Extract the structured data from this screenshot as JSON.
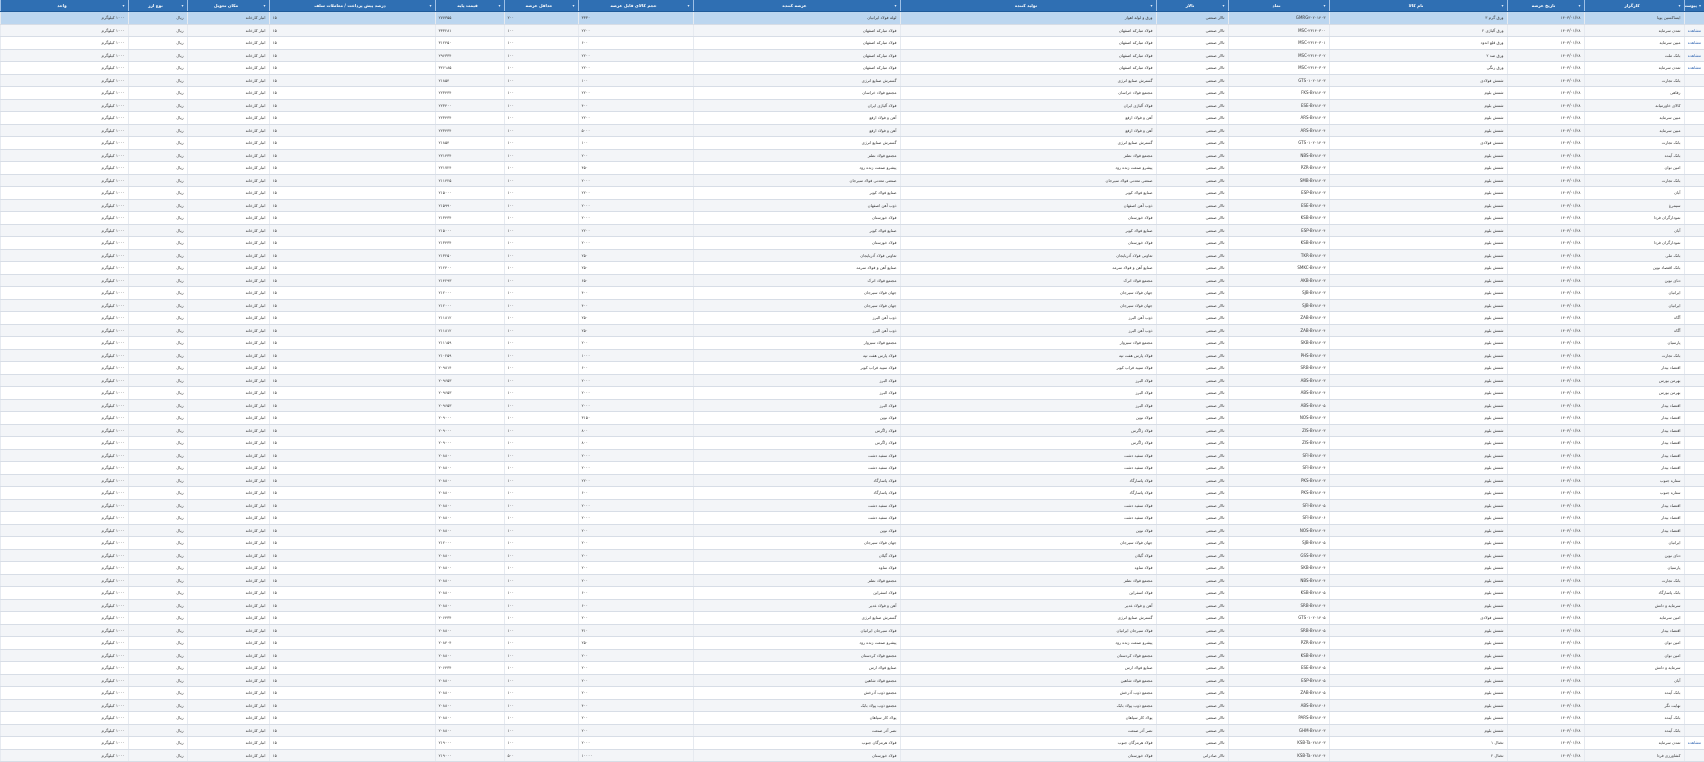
{
  "columns": [
    "پیوست",
    "کارگزار",
    "تاریخ عرضه",
    "نام کالا",
    "نماد",
    "تالار",
    "تولید کننده",
    "عرضه کننده",
    "حجم کالای قابل عرضه",
    "حداقل عرضه",
    "قیمت پایه",
    "درصد پیش پرداخت / معاملات سلف",
    "مکان تحویل",
    "نوع ارز",
    "واحد"
  ],
  "rows": [
    [
      "",
      "ایساکسین پویا",
      "۱۴۰۳/۰۱/۲۸",
      "ورق گرم ۳",
      "GMRG۳۰۲۰۱۴۰۳",
      "تالار صنعتی",
      "ورق و لوله اهواز",
      "لوله فولاد ایرانیان",
      "۳۳۳۰",
      "۲۰۰",
      "۲۷۷۳۵۵",
      "۱۵",
      "انبار کارخانه",
      "ریال",
      "۱۰۰۰ کیلوگرم"
    ],
    [
      "مشاهده",
      "تمدن سرمایه",
      "۱۴۰۳/۰۱/۲۸",
      "ورق آلیاژی ۲",
      "MSC-۲۳۱۴۰۳۰۰",
      "تالار صنعتی",
      "فولاد مبارکه اصفهان",
      "فولاد مبارکه اصفهان",
      "۲۲۰۰",
      "۱۰۰",
      "۳۳۳۲۸۱",
      "۱۵",
      "انبار کارخانه",
      "ریال",
      "۱۰۰۰ کیلوگرم"
    ],
    [
      "مشاهده",
      "مبین سرمایه",
      "۱۴۰۳/۰۱/۲۸",
      "ورق قلع اندود",
      "MSC-۲۳۱۴۰۳۰۱",
      "تالار صنعتی",
      "فولاد مبارکه اصفهان",
      "فولاد مبارکه اصفهان",
      "۶۰۰",
      "۱۰۰",
      "۳۱۲۴۵۰",
      "۱۵",
      "انبار کارخانه",
      "ریال",
      "۱۰۰۰ کیلوگرم"
    ],
    [
      "مشاهده",
      "بانک ملت",
      "۱۴۰۳/۰۱/۲۸",
      "ورق ضد ۲",
      "MSC-۲۳۱۴۰۳۰۲",
      "تالار صنعتی",
      "فولاد مبارکه اصفهان",
      "فولاد مبارکه اصفهان",
      "۲۲۰۰",
      "۱۰۰",
      "۲۹۶۳۳۴",
      "۱۵",
      "انبار کارخانه",
      "ریال",
      "۱۰۰۰ کیلوگرم"
    ],
    [
      "مشاهده",
      "تمدن سرمایه",
      "۱۴۰۳/۰۱/۲۸",
      "ورق رنگی",
      "MSC-۲۳۱۴۰۳۰۳",
      "تالار صنعتی",
      "فولاد مبارکه اصفهان",
      "فولاد مبارکه اصفهان",
      "۲۲۰۰",
      "۱۰۰",
      "۳۲۶۱۸۵",
      "۱۵",
      "انبار کارخانه",
      "ریال",
      "۱۰۰۰ کیلوگرم"
    ],
    [
      "",
      "بانک تجارت",
      "۱۴۰۳/۰۱/۲۸",
      "شمش فولادی",
      "GTS۰۱۰۲۰۱۴۰۳",
      "تالار صنعتی",
      "گسترش صنایع انرژی",
      "گسترش صنایع انرژی",
      "۱۰۰",
      "۱۰۰",
      "۲۱۸۵۴",
      "۱۵",
      "انبار کارخانه",
      "ریال",
      "۱۰۰۰ کیلوگرم"
    ],
    [
      "",
      "رفاهی",
      "۱۴۰۳/۰۱/۲۸",
      "شمش بلوم",
      "FKS-B۲۸۱۴۰۳",
      "تالار صنعتی",
      "مجتمع فولاد خراسان",
      "مجتمع فولاد خراسان",
      "۲۲۰۰",
      "۱۰۰",
      "۲۲۳۴۳۴",
      "۱۵",
      "انبار کارخانه",
      "ریال",
      "۱۰۰۰ کیلوگرم"
    ],
    [
      "",
      "کالای خاورمیانه",
      "۱۴۰۳/۰۱/۲۸",
      "شمش بلوم",
      "ESE-B۲۸۱۴۰۳",
      "تالار صنعتی",
      "فولاد آلیاژی ایران",
      "فولاد آلیاژی ایران",
      "۴۰۰",
      "۱۰۰",
      "۲۲۳۴۰۰",
      "۱۵",
      "انبار کارخانه",
      "ریال",
      "۱۰۰۰ کیلوگرم"
    ],
    [
      "",
      "مبین سرمایه",
      "۱۴۰۳/۰۱/۲۸",
      "شمش بلوم",
      "ARS-B۲۸۱۴۰۳",
      "تالار صنعتی",
      "آهن و فولاد ارفع",
      "آهن و فولاد ارفع",
      "۲۲۰۰",
      "۱۰۰",
      "۲۲۳۴۳۴",
      "۱۵",
      "انبار کارخانه",
      "ریال",
      "۱۰۰۰ کیلوگرم"
    ],
    [
      "",
      "مبین سرمایه",
      "۱۴۰۳/۰۱/۲۸",
      "شمش بلوم",
      "ARS-B۲۸۱۴۰۴",
      "تالار صنعتی",
      "آهن و فولاد ارفع",
      "آهن و فولاد ارفع",
      "۵۰۰۰",
      "۱۰۰",
      "۲۲۳۴۳۴",
      "۱۵",
      "انبار کارخانه",
      "ریال",
      "۱۰۰۰ کیلوگرم"
    ],
    [
      "",
      "بانک تجارت",
      "۱۴۰۳/۰۱/۲۸",
      "شمش فولادی",
      "GTS۰۱۰۲۰۱۴۰۴",
      "تالار صنعتی",
      "گسترش صنایع انرژی",
      "گسترش صنایع انرژی",
      "۱۰۰",
      "۱۰۰",
      "۲۱۸۵۴",
      "۱۵",
      "انبار کارخانه",
      "ریال",
      "۱۰۰۰ کیلوگرم"
    ],
    [
      "",
      "بانک آینده",
      "۱۴۰۳/۰۱/۲۸",
      "شمش بلوم",
      "NBS-B۲۸۱۴۰۳",
      "تالار صنعتی",
      "مجتمع فولاد نطنز",
      "مجتمع فولاد نطنز",
      "۲۰۰",
      "۱۰۰",
      "۲۲۱۴۳۴",
      "۱۵",
      "انبار کارخانه",
      "ریال",
      "۱۰۰۰ کیلوگرم"
    ],
    [
      "",
      "امین توان",
      "۱۴۰۳/۰۱/۲۸",
      "شمش بلوم",
      "PZR-B۲۸۱۴۰۳",
      "تالار صنعتی",
      "پیشرو صنعت زنده رود",
      "پیشرو صنعت زنده رود",
      "۴۵۰",
      "۱۰۰",
      "۲۲۱۷۲۴",
      "۱۵",
      "انبار کارخانه",
      "ریال",
      "۱۰۰۰ کیلوگرم"
    ],
    [
      "",
      "بانک تجارت",
      "۱۴۰۳/۰۱/۲۸",
      "شمش بلوم",
      "SMB-B۲۸۱۴۰۳",
      "تالار صنعتی",
      "صنعتی معدنی فولاد سیرجان",
      "صنعتی معدنی فولاد سیرجان",
      "۲۰۰۰",
      "۱۰۰",
      "۲۱۱۴۲۵",
      "۱۵",
      "انبار کارخانه",
      "ریال",
      "۱۰۰۰ کیلوگرم"
    ],
    [
      "",
      "آبان",
      "۱۴۰۳/۰۱/۲۸",
      "شمش بلوم",
      "ESP-B۲۸۱۴۰۳",
      "تالار صنعتی",
      "صنایع فولاد کویر",
      "صنایع فولاد کویر",
      "۲۲۰۰",
      "۱۰۰",
      "۲۱۵۰۰۰",
      "۱۵",
      "انبار کارخانه",
      "ریال",
      "۱۰۰۰ کیلوگرم"
    ],
    [
      "",
      "سیمرغ",
      "۱۴۰۳/۰۱/۲۸",
      "شمش بلوم",
      "ESE-B۲۸۱۴۰۴",
      "تالار صنعتی",
      "ذوب آهن اصفهان",
      "ذوب آهن اصفهان",
      "۲۰۰۰",
      "۱۰۰",
      "۲۱۵۹۹۰",
      "۱۵",
      "انبار کارخانه",
      "ریال",
      "۱۰۰۰ کیلوگرم"
    ],
    [
      "",
      "نمودارگران فردا",
      "۱۴۰۳/۰۱/۲۸",
      "شمش بلوم",
      "KSB-B۲۸۱۴۰۳",
      "تالار صنعتی",
      "فولاد خوزستان",
      "فولاد خوزستان",
      "۲۰۰۰",
      "۱۰۰",
      "۲۱۳۴۳۴",
      "۱۵",
      "انبار کارخانه",
      "ریال",
      "۱۰۰۰ کیلوگرم"
    ],
    [
      "",
      "آبان",
      "۱۴۰۳/۰۱/۲۸",
      "شمش بلوم",
      "ESP-B۲۸۱۴۰۴",
      "تالار صنعتی",
      "صنایع فولاد کویر",
      "صنایع فولاد کویر",
      "۲۲۰۰",
      "۱۰۰",
      "۲۱۵۰۰۰",
      "۱۵",
      "انبار کارخانه",
      "ریال",
      "۱۰۰۰ کیلوگرم"
    ],
    [
      "",
      "نمودارگران فردا",
      "۱۴۰۳/۰۱/۲۸",
      "شمش بلوم",
      "KSB-B۲۸۱۴۰۴",
      "تالار صنعتی",
      "فولاد خوزستان",
      "فولاد خوزستان",
      "۲۰۰۰",
      "۱۰۰",
      "۲۱۳۴۳۴",
      "۱۵",
      "انبار کارخانه",
      "ریال",
      "۱۰۰۰ کیلوگرم"
    ],
    [
      "",
      "بانک ملی",
      "۱۴۰۳/۰۱/۲۸",
      "شمش بلوم",
      "TKR-B۲۸۱۴۰۳",
      "تالار صنعتی",
      "تعاونی فولاد آذربایجان",
      "تعاونی فولاد آذربایجان",
      "۲۵۰",
      "۱۰۰",
      "۲۱۳۲۵۰",
      "۱۵",
      "انبار کارخانه",
      "ریال",
      "۱۰۰۰ کیلوگرم"
    ],
    [
      "",
      "بانک اقتصاد نوین",
      "۱۴۰۳/۰۱/۲۸",
      "شمش بلوم",
      "SMKC-B۲۸۱۴۰۳",
      "تالار صنعتی",
      "صنایع آهن و فولاد سرمد",
      "صنایع آهن و فولاد سرمد",
      "۲۵۰",
      "۱۰۰",
      "۲۱۲۴۰۰",
      "۱۵",
      "انبار کارخانه",
      "ریال",
      "۱۰۰۰ کیلوگرم"
    ],
    [
      "",
      "دنای نوین",
      "۱۴۰۳/۰۱/۲۸",
      "شمش بلوم",
      "AKB-B۲۸۱۴۰۳",
      "تالار صنعتی",
      "مجتمع فولاد اترک",
      "مجتمع فولاد اترک",
      "۶۵۰",
      "۱۰۰",
      "۲۱۴۲۹۳",
      "۱۵",
      "انبار کارخانه",
      "ریال",
      "۱۰۰۰ کیلوگرم"
    ],
    [
      "",
      "ایرانیان",
      "۱۴۰۳/۰۱/۲۸",
      "شمش بلوم",
      "SJB-B۲۸۱۴۰۳",
      "تالار صنعتی",
      "جهان فولاد سیرجان",
      "جهان فولاد سیرجان",
      "۴۰۰",
      "۱۰۰",
      "۲۱۲۰۰۰",
      "۱۵",
      "انبار کارخانه",
      "ریال",
      "۱۰۰۰ کیلوگرم"
    ],
    [
      "",
      "ایرانیان",
      "۱۴۰۳/۰۱/۲۸",
      "شمش بلوم",
      "SJB-B۲۸۱۴۰۴",
      "تالار صنعتی",
      "جهان فولاد سیرجان",
      "جهان فولاد سیرجان",
      "۴۰۰",
      "۱۰۰",
      "۲۱۲۰۰۰",
      "۱۵",
      "انبار کارخانه",
      "ریال",
      "۱۰۰۰ کیلوگرم"
    ],
    [
      "",
      "آگاه",
      "۱۴۰۳/۰۱/۲۸",
      "شمش بلوم",
      "ZAB-B۲۸۱۴۰۳",
      "تالار صنعتی",
      "ذوب آهن البرز",
      "ذوب آهن البرز",
      "۲۵۰",
      "۱۰۰",
      "۲۱۱۸۱۲",
      "۱۵",
      "انبار کارخانه",
      "ریال",
      "۱۰۰۰ کیلوگرم"
    ],
    [
      "",
      "آگاه",
      "۱۴۰۳/۰۱/۲۸",
      "شمش بلوم",
      "ZAB-B۲۸۱۴۰۴",
      "تالار صنعتی",
      "ذوب آهن البرز",
      "ذوب آهن البرز",
      "۲۵۰",
      "۱۰۰",
      "۲۱۱۸۱۲",
      "۱۵",
      "انبار کارخانه",
      "ریال",
      "۱۰۰۰ کیلوگرم"
    ],
    [
      "",
      "پارسیان",
      "۱۴۰۳/۰۱/۲۸",
      "شمش بلوم",
      "SKB-B۲۸۱۴۰۳",
      "تالار صنعتی",
      "مجتمع فولاد سبزوار",
      "مجتمع فولاد سبزوار",
      "۲۰۰",
      "۱۰۰",
      "۲۱۱۱۵۹",
      "۱۵",
      "انبار کارخانه",
      "ریال",
      "۱۰۰۰ کیلوگرم"
    ],
    [
      "",
      "بانک تجارت",
      "۱۴۰۳/۰۱/۲۸",
      "شمش بلوم",
      "PHS-B۲۸۱۴۰۳",
      "تالار صنعتی",
      "فولاد پارس هفت تپه",
      "فولاد پارس هفت تپه",
      "۱۰۰۰",
      "۱۰۰",
      "۲۱۰۲۵۹",
      "۱۵",
      "انبار کارخانه",
      "ریال",
      "۱۰۰۰ کیلوگرم"
    ],
    [
      "",
      "اقتصاد بیدار",
      "۱۴۰۳/۰۱/۲۸",
      "شمش بلوم",
      "SRB-B۲۸۱۴۰۳",
      "تالار صنعتی",
      "فولاد سپید فراب کویر",
      "فولاد سپید فراب کویر",
      "۶۰۰",
      "۱۰۰",
      "۲۰۹۸۱۴",
      "۱۵",
      "انبار کارخانه",
      "ریال",
      "۱۰۰۰ کیلوگرم"
    ],
    [
      "",
      "بهرمن بورس",
      "۱۴۰۳/۰۱/۲۸",
      "شمش بلوم",
      "ABS-B۲۸۱۴۰۳",
      "تالار صنعتی",
      "فولاد البرز",
      "فولاد البرز",
      "۲۰۰۰",
      "۱۰۰",
      "۲۰۹۶۵۳",
      "۱۵",
      "انبار کارخانه",
      "ریال",
      "۱۰۰۰ کیلوگرم"
    ],
    [
      "",
      "بهرمن بورس",
      "۱۴۰۳/۰۱/۲۸",
      "شمش بلوم",
      "ABS-B۲۸۱۴۰۴",
      "تالار صنعتی",
      "فولاد البرز",
      "فولاد البرز",
      "۲۰۰۰",
      "۱۰۰",
      "۲۰۹۶۵۳",
      "۱۵",
      "انبار کارخانه",
      "ریال",
      "۱۰۰۰ کیلوگرم"
    ],
    [
      "",
      "اقتصاد بیدار",
      "۱۴۰۳/۰۱/۲۸",
      "شمش بلوم",
      "ABS-B۲۸۱۴۰۵",
      "تالار صنعتی",
      "فولاد البرز",
      "فولاد البرز",
      "۲۰۰۰",
      "۱۰۰",
      "۲۰۹۶۵۳",
      "۱۵",
      "انبار کارخانه",
      "ریال",
      "۱۰۰۰ کیلوگرم"
    ],
    [
      "",
      "اقتصاد بیدار",
      "۱۴۰۳/۰۱/۲۸",
      "شمش بلوم",
      "NOS-B۲۸۱۴۰۳",
      "تالار صنعتی",
      "فولاد نوین",
      "فولاد نوین",
      "۳۱۵۰",
      "۱۰۰",
      "۲۰۹۰۰۰",
      "۱۵",
      "انبار کارخانه",
      "ریال",
      "۱۰۰۰ کیلوگرم"
    ],
    [
      "",
      "اقتصاد بیدار",
      "۱۴۰۳/۰۱/۲۸",
      "شمش بلوم",
      "ZIS-B۲۸۱۴۰۳",
      "تالار صنعتی",
      "فولاد زاگرس",
      "فولاد زاگرس",
      "۸۰۰",
      "۱۰۰",
      "۲۰۹۰۰۰",
      "۱۵",
      "انبار کارخانه",
      "ریال",
      "۱۰۰۰ کیلوگرم"
    ],
    [
      "",
      "اقتصاد بیدار",
      "۱۴۰۳/۰۱/۲۸",
      "شمش بلوم",
      "ZIS-B۲۸۱۴۰۴",
      "تالار صنعتی",
      "فولاد زاگرس",
      "فولاد زاگرس",
      "۸۰۰",
      "۱۰۰",
      "۲۰۹۰۰۰",
      "۱۵",
      "انبار کارخانه",
      "ریال",
      "۱۰۰۰ کیلوگرم"
    ],
    [
      "",
      "اقتصاد بیدار",
      "۱۴۰۳/۰۱/۲۸",
      "شمش بلوم",
      "SFI-B۲۸۱۴۰۳",
      "تالار صنعتی",
      "فولاد سفید دشت",
      "فولاد سفید دشت",
      "۲۰۰۰",
      "۱۰۰",
      "۲۰۸۸۰۰",
      "۱۵",
      "انبار کارخانه",
      "ریال",
      "۱۰۰۰ کیلوگرم"
    ],
    [
      "",
      "اقتصاد بیدار",
      "۱۴۰۳/۰۱/۲۸",
      "شمش بلوم",
      "SFI-B۲۸۱۴۰۴",
      "تالار صنعتی",
      "فولاد سفید دشت",
      "فولاد سفید دشت",
      "۲۰۰۰",
      "۱۰۰",
      "۲۰۸۸۰۰",
      "۱۵",
      "انبار کارخانه",
      "ریال",
      "۱۰۰۰ کیلوگرم"
    ],
    [
      "",
      "ستاره جنوب",
      "۱۴۰۳/۰۱/۲۸",
      "شمش بلوم",
      "PKS-B۲۸۱۴۰۳",
      "تالار صنعتی",
      "فولاد پاسارگاد",
      "فولاد پاسارگاد",
      "۲۲۰۰",
      "۱۰۰",
      "۲۰۸۸۰۰",
      "۱۵",
      "انبار کارخانه",
      "ریال",
      "۱۰۰۰ کیلوگرم"
    ],
    [
      "",
      "ستاره جنوب",
      "۱۴۰۳/۰۱/۲۸",
      "شمش بلوم",
      "PKS-B۲۸۱۴۰۴",
      "تالار صنعتی",
      "فولاد پاسارگاد",
      "فولاد پاسارگاد",
      "۶۰۰",
      "۱۰۰",
      "۲۰۸۸۰۰",
      "۱۵",
      "انبار کارخانه",
      "ریال",
      "۱۰۰۰ کیلوگرم"
    ],
    [
      "",
      "اقتصاد بیدار",
      "۱۴۰۳/۰۱/۲۸",
      "شمش بلوم",
      "SFI-B۲۸۱۴۰۵",
      "تالار صنعتی",
      "فولاد سفید دشت",
      "فولاد سفید دشت",
      "۲۰۰۰",
      "۱۰۰",
      "۲۰۸۸۰۰",
      "۱۵",
      "انبار کارخانه",
      "ریال",
      "۱۰۰۰ کیلوگرم"
    ],
    [
      "",
      "اقتصاد بیدار",
      "۱۴۰۳/۰۱/۲۸",
      "شمش بلوم",
      "SFI-B۲۸۱۴۰۶",
      "تالار صنعتی",
      "فولاد سفید دشت",
      "فولاد سفید دشت",
      "۲۰۰۰",
      "۱۰۰",
      "۲۰۸۸۰۰",
      "۱۵",
      "انبار کارخانه",
      "ریال",
      "۱۰۰۰ کیلوگرم"
    ],
    [
      "",
      "اقتصاد بیدار",
      "۱۴۰۳/۰۱/۲۸",
      "شمش بلوم",
      "NOS-B۲۸۱۴۰۴",
      "تالار صنعتی",
      "فولاد نوین",
      "فولاد نوین",
      "۲۰۰",
      "۱۰۰",
      "۲۰۸۸۰۰",
      "۱۵",
      "انبار کارخانه",
      "ریال",
      "۱۰۰۰ کیلوگرم"
    ],
    [
      "",
      "ایرانیان",
      "۱۴۰۳/۰۱/۲۸",
      "شمش بلوم",
      "SJB-B۲۸۱۴۰۵",
      "تالار صنعتی",
      "جهان فولاد سیرجان",
      "جهان فولاد سیرجان",
      "۲۰۰",
      "۱۰۰",
      "۲۱۲۰۰۰",
      "۱۵",
      "انبار کارخانه",
      "ریال",
      "۱۰۰۰ کیلوگرم"
    ],
    [
      "",
      "دنای نوین",
      "۱۴۰۳/۰۱/۲۸",
      "شمش بلوم",
      "GSS-B۲۸۱۴۰۳",
      "تالار صنعتی",
      "فولاد گیلان",
      "فولاد گیلان",
      "۲۰۰",
      "۱۰۰",
      "۲۰۸۸۰۰",
      "۱۵",
      "انبار کارخانه",
      "ریال",
      "۱۰۰۰ کیلوگرم"
    ],
    [
      "",
      "پارسیان",
      "۱۴۰۳/۰۱/۲۸",
      "شمش بلوم",
      "SKB-B۲۸۱۴۰۴",
      "تالار صنعتی",
      "فولاد ساوه",
      "فولاد ساوه",
      "۲۰۰",
      "۱۰۰",
      "۲۰۸۸۰۰",
      "۱۵",
      "انبار کارخانه",
      "ریال",
      "۱۰۰۰ کیلوگرم"
    ],
    [
      "",
      "بانک تجارت",
      "۱۴۰۳/۰۱/۲۸",
      "شمش بلوم",
      "NBS-B۲۸۱۴۰۴",
      "تالار صنعتی",
      "مجتمع فولاد نطنز",
      "مجتمع فولاد نطنز",
      "۲۰۰",
      "۱۰۰",
      "۲۰۸۸۰۰",
      "۱۵",
      "انبار کارخانه",
      "ریال",
      "۱۰۰۰ کیلوگرم"
    ],
    [
      "",
      "بانک پاسارگاد",
      "۱۴۰۳/۰۱/۲۸",
      "شمش بلوم",
      "KSB-B۲۸۱۴۰۵",
      "تالار صنعتی",
      "فولاد اسفراین",
      "فولاد اسفراین",
      "۶۰۰",
      "۱۰۰",
      "۲۰۸۸۰۰",
      "۱۵",
      "انبار کارخانه",
      "ریال",
      "۱۰۰۰ کیلوگرم"
    ],
    [
      "",
      "سرمایه و دانش",
      "۱۴۰۳/۰۱/۲۸",
      "شمش بلوم",
      "SRB-B۲۸۱۴۰۴",
      "تالار صنعتی",
      "آهن و فولاد غدیر",
      "آهن و فولاد غدیر",
      "۶۰۰",
      "۱۰۰",
      "۲۰۸۸۰۰",
      "۱۵",
      "انبار کارخانه",
      "ریال",
      "۱۰۰۰ کیلوگرم"
    ],
    [
      "",
      "امین سرمایه",
      "۱۴۰۳/۰۱/۲۸",
      "شمش فولادی",
      "GTS۰۱۰۲۰۱۴۰۵",
      "تالار صنعتی",
      "گسترش صنایع انرژی",
      "گسترش صنایع انرژی",
      "۲۰۰",
      "۱۰۰",
      "۲۰۶۴۳۴",
      "۱۵",
      "انبار کارخانه",
      "ریال",
      "۱۰۰۰ کیلوگرم"
    ],
    [
      "",
      "اقتصاد بیدار",
      "۱۴۰۳/۰۱/۲۸",
      "شمش بلوم",
      "SRB-B۲۸۱۴۰۵",
      "تالار صنعتی",
      "فولاد سیرجان ایرانیان",
      "فولاد سیرجان ایرانیان",
      "۳۱۰",
      "۱۰۰",
      "۲۰۸۸۰۰",
      "۱۵",
      "انبار کارخانه",
      "ریال",
      "۱۰۰۰ کیلوگرم"
    ],
    [
      "",
      "امین توان",
      "۱۴۰۳/۰۱/۲۸",
      "شمش بلوم",
      "PZR-B۲۸۱۴۰۴",
      "تالار صنعتی",
      "پیشرو صنعت زنده رود",
      "پیشرو صنعت زنده رود",
      "۲۵۰",
      "۱۰۰",
      "۲۰۸۴۰۴",
      "۱۵",
      "انبار کارخانه",
      "ریال",
      "۱۰۰۰ کیلوگرم"
    ],
    [
      "",
      "امین توان",
      "۱۴۰۳/۰۱/۲۸",
      "شمش بلوم",
      "KSB-B۲۸۱۴۰۶",
      "تالار صنعتی",
      "مجتمع فولاد کردستان",
      "مجتمع فولاد کردستان",
      "۲۰۰",
      "۱۰۰",
      "۲۰۸۸۰۰",
      "۱۵",
      "انبار کارخانه",
      "ریال",
      "۱۰۰۰ کیلوگرم"
    ],
    [
      "",
      "سرمایه و دانش",
      "۱۴۰۳/۰۱/۲۸",
      "شمش بلوم",
      "ESE-B۲۸۱۴۰۵",
      "تالار صنعتی",
      "صنایع فولاد ارس",
      "صنایع فولاد ارس",
      "۲۰۰",
      "۱۰۰",
      "۲۰۶۴۳۴",
      "۱۵",
      "انبار کارخانه",
      "ریال",
      "۱۰۰۰ کیلوگرم"
    ],
    [
      "",
      "آبان",
      "۱۴۰۳/۰۱/۲۸",
      "شمش بلوم",
      "ESP-B۲۸۱۴۰۵",
      "تالار صنعتی",
      "مجتمع فولاد شاهین",
      "مجتمع فولاد شاهین",
      "۲۰۰",
      "۱۰۰",
      "۲۰۸۸۰۰",
      "۱۵",
      "انبار کارخانه",
      "ریال",
      "۱۰۰۰ کیلوگرم"
    ],
    [
      "",
      "بانک آینده",
      "۱۴۰۳/۰۱/۲۸",
      "شمش بلوم",
      "ZAB-B۲۸۱۴۰۵",
      "تالار صنعتی",
      "مجتمع ذوب آذرخش",
      "مجتمع ذوب آذرخش",
      "۲۰۰",
      "۱۰۰",
      "۲۰۸۸۰۰",
      "۱۵",
      "انبار کارخانه",
      "ریال",
      "۱۰۰۰ کیلوگرم"
    ],
    [
      "",
      "نهایت نگر",
      "۱۴۰۳/۰۱/۲۸",
      "شمش بلوم",
      "ABS-B۲۸۱۴۰۶",
      "تالار صنعتی",
      "مجتمع ذوب پولاد بابک",
      "مجتمع ذوب پولاد بابک",
      "۴۰۰",
      "۱۰۰",
      "۲۰۸۸۰۰",
      "۱۵",
      "انبار کارخانه",
      "ریال",
      "۱۰۰۰ کیلوگرم"
    ],
    [
      "",
      "بانک آینده",
      "۱۴۰۳/۰۱/۲۸",
      "شمش بلوم",
      "PARS-B۲۸۱۴۰۳",
      "تالار صنعتی",
      "پولاد کار سپاهان",
      "پولاد کار سپاهان",
      "۲۰۰",
      "۱۰۰",
      "۲۰۸۸۰۰",
      "۱۵",
      "انبار کارخانه",
      "ریال",
      "۱۰۰۰ کیلوگرم"
    ],
    [
      "",
      "بانک آینده",
      "۱۴۰۳/۰۱/۲۸",
      "شمش بلوم",
      "GHM-B۲۸۱۴۰۳",
      "تالار صنعتی",
      "نصر آذر صنعت",
      "نصر آذر صنعت",
      "۲۰۰",
      "۱۰۰",
      "۲۰۸۸۰۰",
      "۱۵",
      "انبار کارخانه",
      "ریال",
      "۱۰۰۰ کیلوگرم"
    ],
    [
      "مشاهده",
      "تمدن سرمایه",
      "۱۴۰۳/۰۱/۲۸",
      "تختال ۱",
      "KSB-Ta۰۲۸۱۴۰۳",
      "تالار صنعتی",
      "فولاد هرمزگان جنوب",
      "فولاد هرمزگان جنوب",
      "۲۰۰۰",
      "۱۰۰",
      "۲۱۹۰۰۰",
      "۱۵",
      "انبار کارخانه",
      "ریال",
      "۱۰۰۰ کیلوگرم"
    ],
    [
      "",
      "کشاورزی فردا",
      "۱۴۰۳/۰۱/۲۸",
      "تختال ۲",
      "KSB-Ta۰۲۸۱۴۰۴",
      "تالار صادراتی",
      "فولاد خوزستان",
      "فولاد خوزستان",
      "۱۰۰۰۰",
      "۵۰۰",
      "۲۱۹۰۰۰",
      "۱۵",
      "انبار کارخانه",
      "ریال",
      "۱۰۰۰ کیلوگرم"
    ]
  ]
}
